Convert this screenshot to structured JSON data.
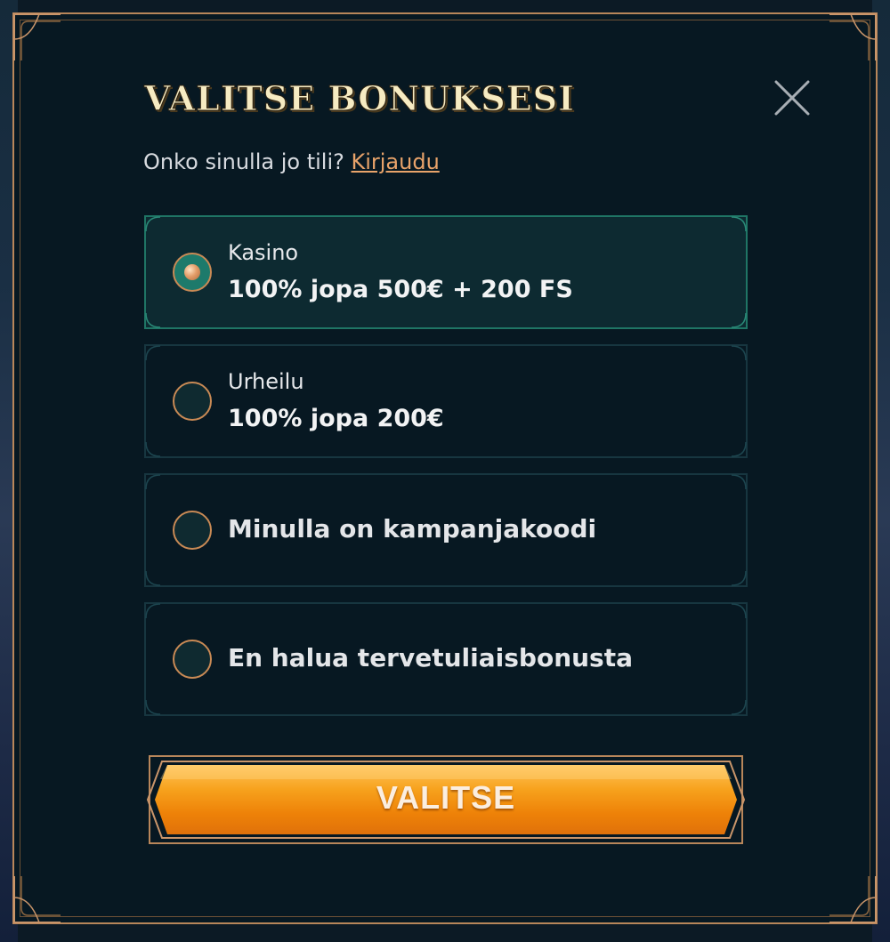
{
  "modal": {
    "title": "VALITSE BONUKSESI",
    "close_icon": "close-icon",
    "subtitle": {
      "text": "Onko sinulla jo tili? ",
      "link": "Kirjaudu"
    }
  },
  "options": [
    {
      "label": "Kasino",
      "value": "100% jopa 500€ + 200 FS",
      "selected": true
    },
    {
      "label": "Urheilu",
      "value": "100% jopa 200€",
      "selected": false
    },
    {
      "label": "Minulla on kampanjakoodi",
      "selected": false
    },
    {
      "label": "En halua tervetuliaisbonusta",
      "selected": false
    }
  ],
  "cta": {
    "label": "VALITSE"
  },
  "colors": {
    "accent_gold": "#b8865a",
    "cta_orange": "#f08a0e",
    "selected_teal": "#1f7565",
    "title_cream": "#f6ebc2",
    "link_orange": "#e8a36a"
  }
}
